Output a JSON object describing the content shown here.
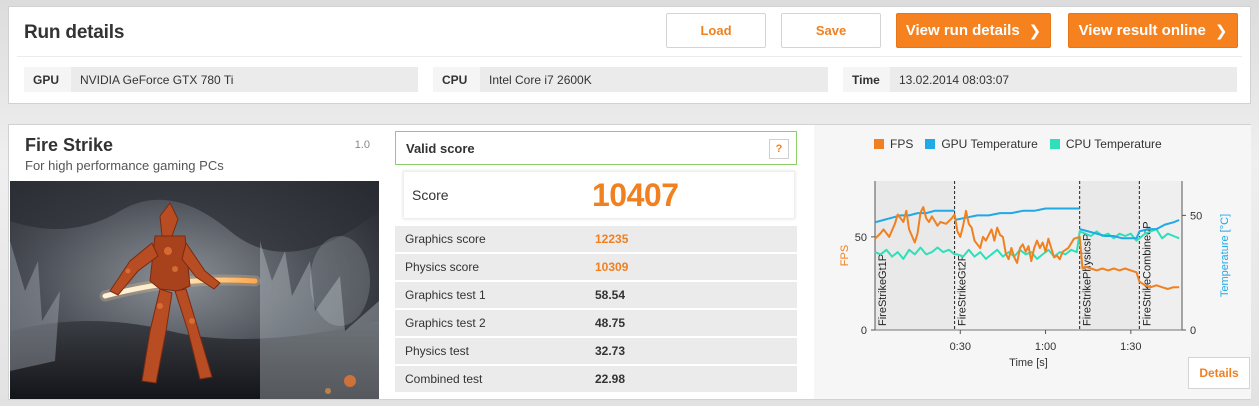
{
  "header": {
    "title": "Run details",
    "load_label": "Load",
    "save_label": "Save",
    "view_run_label": "View run details",
    "view_online_label": "View result online",
    "chevron": "❯"
  },
  "system": {
    "gpu_label": "GPU",
    "gpu_value": "NVIDIA GeForce GTX 780 Ti",
    "cpu_label": "CPU",
    "cpu_value": "Intel Core i7 2600K",
    "time_label": "Time",
    "time_value": "13.02.2014 08:03:07"
  },
  "benchmark": {
    "name": "Fire Strike",
    "subtitle": "For high performance gaming PCs",
    "version": "1.0",
    "image": "Fire Strike scene artwork — fiery armored figure with glowing sword in a stormy scene"
  },
  "score": {
    "valid_label": "Valid score",
    "help_label": "?",
    "label": "Score",
    "value": "10407",
    "rows": [
      {
        "label": "Graphics score",
        "value": "12235",
        "highlight": true
      },
      {
        "label": "Physics score",
        "value": "10309",
        "highlight": true
      },
      {
        "label": "Graphics test 1",
        "value": "58.54",
        "highlight": false
      },
      {
        "label": "Graphics test 2",
        "value": "48.75",
        "highlight": false
      },
      {
        "label": "Physics test",
        "value": "32.73",
        "highlight": false
      },
      {
        "label": "Combined test",
        "value": "22.98",
        "highlight": false
      }
    ]
  },
  "chart": {
    "details_label": "Details"
  },
  "colors": {
    "accent": "#f5821f",
    "fps": "#f08020",
    "gpu_temp": "#1fa9e6",
    "cpu_temp": "#2de0b8",
    "valid": "#8fcf6a"
  },
  "chart_data": {
    "type": "line",
    "xlabel": "Time [s]",
    "ylabel_left": "FPS",
    "ylabel_right": "Temperature [°C]",
    "x_ticks": [
      "0:30",
      "1:00",
      "1:30"
    ],
    "y_ticks_left": [
      "0",
      "50"
    ],
    "y_ticks_right": [
      "0",
      "50"
    ],
    "xlim": [
      0,
      108
    ],
    "ylim_left": [
      0,
      80
    ],
    "ylim_right": [
      0,
      65
    ],
    "grid": false,
    "legend_position": "top",
    "sections": [
      {
        "label": "FireStrikeGt1P",
        "start": 0,
        "end": 28
      },
      {
        "label": "FireStrikeGt2P",
        "start": 28,
        "end": 72
      },
      {
        "label": "FireStrikePhysicsP",
        "start": 72,
        "end": 93
      },
      {
        "label": "FireStrikeCombinedP",
        "start": 93,
        "end": 108
      }
    ],
    "series": [
      {
        "name": "FPS",
        "axis": "left",
        "points": [
          [
            0,
            49
          ],
          [
            2,
            52
          ],
          [
            3,
            54
          ],
          [
            5,
            50
          ],
          [
            7,
            57
          ],
          [
            8,
            62
          ],
          [
            10,
            58
          ],
          [
            11,
            64
          ],
          [
            12,
            54
          ],
          [
            14,
            47
          ],
          [
            15,
            52
          ],
          [
            16,
            63
          ],
          [
            17,
            66
          ],
          [
            18,
            60
          ],
          [
            19,
            58
          ],
          [
            20,
            61
          ],
          [
            22,
            56
          ],
          [
            23,
            58
          ],
          [
            25,
            57
          ],
          [
            27,
            60
          ],
          [
            28,
            62
          ],
          [
            29,
            53
          ],
          [
            30,
            50
          ],
          [
            31,
            56
          ],
          [
            32,
            64
          ],
          [
            33,
            57
          ],
          [
            34,
            55
          ],
          [
            35,
            48
          ],
          [
            36,
            46
          ],
          [
            37,
            44
          ],
          [
            38,
            50
          ],
          [
            39,
            48
          ],
          [
            41,
            54
          ],
          [
            42,
            48
          ],
          [
            43,
            55
          ],
          [
            44,
            51
          ],
          [
            45,
            50
          ],
          [
            46,
            41
          ],
          [
            47,
            38
          ],
          [
            48,
            44
          ],
          [
            49,
            39
          ],
          [
            50,
            36
          ],
          [
            51,
            44
          ],
          [
            52,
            46
          ],
          [
            53,
            42
          ],
          [
            54,
            45
          ],
          [
            55,
            37
          ],
          [
            56,
            44
          ],
          [
            57,
            48
          ],
          [
            58,
            44
          ],
          [
            59,
            47
          ],
          [
            60,
            42
          ],
          [
            61,
            49
          ],
          [
            62,
            44
          ],
          [
            63,
            39
          ],
          [
            64,
            40
          ],
          [
            65,
            38
          ],
          [
            66,
            42
          ],
          [
            68,
            44
          ],
          [
            70,
            49
          ],
          [
            72,
            50
          ],
          [
            73,
            33
          ],
          [
            74,
            34
          ],
          [
            76,
            33
          ],
          [
            78,
            32
          ],
          [
            80,
            33
          ],
          [
            82,
            32
          ],
          [
            84,
            33
          ],
          [
            86,
            32
          ],
          [
            88,
            33
          ],
          [
            90,
            32
          ],
          [
            92,
            31
          ],
          [
            93,
            26
          ],
          [
            95,
            24
          ],
          [
            97,
            23
          ],
          [
            99,
            24
          ],
          [
            101,
            23
          ],
          [
            103,
            22
          ],
          [
            105,
            23
          ],
          [
            107,
            23
          ]
        ]
      },
      {
        "name": "GPU Temperature",
        "axis": "right",
        "points": [
          [
            0,
            47
          ],
          [
            3,
            48
          ],
          [
            6,
            49
          ],
          [
            9,
            50
          ],
          [
            12,
            50
          ],
          [
            15,
            51
          ],
          [
            18,
            51
          ],
          [
            21,
            52
          ],
          [
            24,
            52
          ],
          [
            28,
            52
          ],
          [
            28,
            48
          ],
          [
            32,
            49
          ],
          [
            36,
            50
          ],
          [
            40,
            50
          ],
          [
            44,
            51
          ],
          [
            48,
            51
          ],
          [
            52,
            52
          ],
          [
            56,
            52
          ],
          [
            60,
            53
          ],
          [
            64,
            53
          ],
          [
            68,
            53
          ],
          [
            72,
            53
          ],
          [
            72,
            44
          ],
          [
            75,
            43
          ],
          [
            78,
            42
          ],
          [
            81,
            41
          ],
          [
            84,
            41
          ],
          [
            87,
            40
          ],
          [
            90,
            40
          ],
          [
            92,
            40
          ],
          [
            93,
            43
          ],
          [
            96,
            44
          ],
          [
            99,
            44
          ],
          [
            102,
            46
          ],
          [
            105,
            47
          ],
          [
            107,
            48
          ]
        ]
      },
      {
        "name": "CPU Temperature",
        "axis": "right",
        "points": [
          [
            0,
            34
          ],
          [
            2,
            33
          ],
          [
            4,
            35
          ],
          [
            6,
            32
          ],
          [
            8,
            34
          ],
          [
            10,
            31
          ],
          [
            12,
            35
          ],
          [
            14,
            33
          ],
          [
            16,
            36
          ],
          [
            18,
            33
          ],
          [
            20,
            34
          ],
          [
            22,
            36
          ],
          [
            24,
            34
          ],
          [
            26,
            35
          ],
          [
            28,
            33
          ],
          [
            29,
            33
          ],
          [
            31,
            32
          ],
          [
            33,
            35
          ],
          [
            35,
            32
          ],
          [
            37,
            34
          ],
          [
            39,
            31
          ],
          [
            41,
            33
          ],
          [
            43,
            35
          ],
          [
            45,
            32
          ],
          [
            47,
            34
          ],
          [
            49,
            32
          ],
          [
            51,
            35
          ],
          [
            53,
            33
          ],
          [
            55,
            34
          ],
          [
            57,
            31
          ],
          [
            59,
            33
          ],
          [
            61,
            35
          ],
          [
            63,
            32
          ],
          [
            65,
            34
          ],
          [
            67,
            33
          ],
          [
            69,
            35
          ],
          [
            71,
            34
          ],
          [
            72,
            43
          ],
          [
            74,
            42
          ],
          [
            76,
            41
          ],
          [
            78,
            43
          ],
          [
            80,
            41
          ],
          [
            82,
            42
          ],
          [
            84,
            40
          ],
          [
            86,
            42
          ],
          [
            88,
            41
          ],
          [
            90,
            42
          ],
          [
            92,
            39
          ],
          [
            93,
            40
          ],
          [
            95,
            42
          ],
          [
            97,
            43
          ],
          [
            99,
            44
          ],
          [
            101,
            40
          ],
          [
            103,
            42
          ],
          [
            105,
            41
          ],
          [
            107,
            40
          ]
        ]
      }
    ]
  }
}
